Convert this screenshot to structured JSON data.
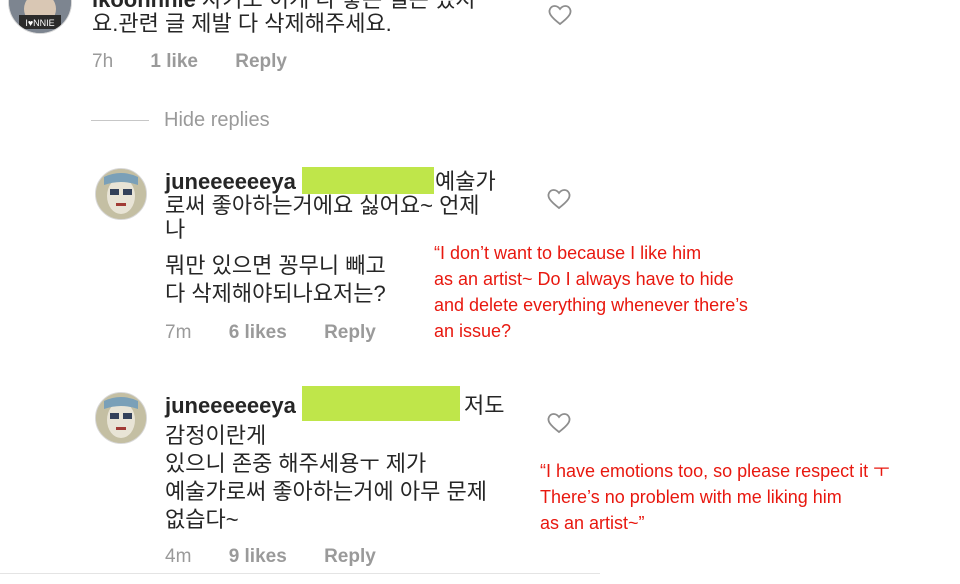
{
  "comment_top": {
    "username": "ikoohnnie",
    "line1_tail": "자기도 이게 다 좋은 일은 였지",
    "line2": "요.관련 글 제발 다 삭제해주세요.",
    "time": "7h",
    "likes": "1 like",
    "reply": "Reply"
  },
  "hide_replies": "Hide replies",
  "replies": [
    {
      "username": "juneeeeeeya",
      "lines": [
        "예술가",
        "로써 좋아하는거에요 싫어요~ 언제",
        "나",
        "뭐만 있으면 꽁무니 빼고",
        "다 삭제해야되나요저는?"
      ],
      "time": "7m",
      "likes": "6 likes",
      "reply": "Reply",
      "translation": [
        "“I don’t want to because I like him",
        "as an artist~ Do I always have to hide",
        "and delete everything whenever there’s",
        "an issue?"
      ]
    },
    {
      "username": "juneeeeeeya",
      "lines": [
        "저도",
        "감정이란게",
        "있으니 존중 해주세용ㅜ 제가",
        "예술가로써 좋아하는거에 아무 문제",
        "없습다~"
      ],
      "time": "4m",
      "likes": "9 likes",
      "reply": "Reply",
      "translation": [
        "“I have emotions too, so please respect it ㅜ",
        "There’s no problem with me liking him",
        "as an artist~”"
      ]
    }
  ],
  "colors": {
    "highlight": "#bfe64a",
    "translation": "#e8180f",
    "meta": "#9a9a9a"
  },
  "icons": {
    "like": "heart-outline-icon",
    "avatar": "profile-avatar"
  }
}
